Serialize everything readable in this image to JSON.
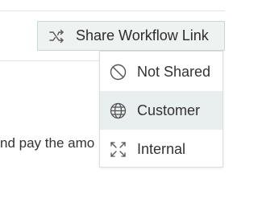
{
  "share_button": {
    "label": "Share Workflow Link",
    "icon": "shuffle-icon"
  },
  "body_text": "nd pay the amo",
  "menu": {
    "items": [
      {
        "label": "Not Shared",
        "icon": "prohibited-icon",
        "active": false
      },
      {
        "label": "Customer",
        "icon": "globe-icon",
        "active": true
      },
      {
        "label": "Internal",
        "icon": "internal-icon",
        "active": false
      }
    ]
  },
  "colors": {
    "button_bg": "#eef3f2",
    "button_border": "#c9d8d6",
    "active_item_bg": "#e8efee",
    "icon": "#555555"
  }
}
